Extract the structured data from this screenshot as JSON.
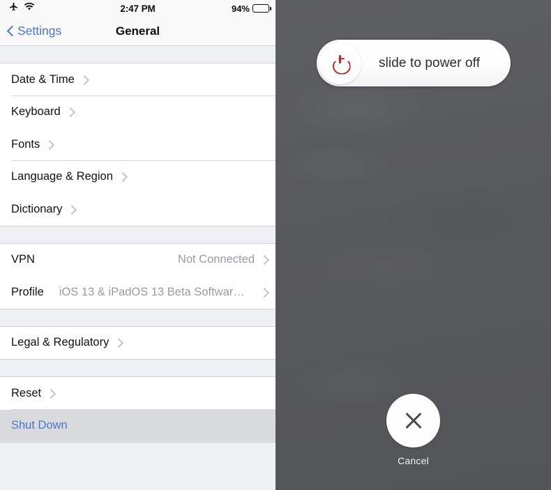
{
  "status_bar": {
    "airplane_icon": "airplane-icon",
    "wifi_icon": "wifi-icon",
    "time": "2:47 PM",
    "battery_percent": "94%",
    "battery_icon": "battery-icon"
  },
  "nav_bar": {
    "back_label": "Settings",
    "back_icon": "chevron-left-icon",
    "title": "General"
  },
  "groups": [
    {
      "rows": [
        {
          "label": "Date & Time",
          "value": "",
          "chevron": true,
          "accent": false,
          "pressed": false
        },
        {
          "label": "Keyboard",
          "value": "",
          "chevron": true,
          "accent": false,
          "pressed": false
        },
        {
          "label": "Fonts",
          "value": "",
          "chevron": true,
          "accent": false,
          "pressed": false
        },
        {
          "label": "Language & Region",
          "value": "",
          "chevron": true,
          "accent": false,
          "pressed": false
        },
        {
          "label": "Dictionary",
          "value": "",
          "chevron": true,
          "accent": false,
          "pressed": false
        }
      ]
    },
    {
      "rows": [
        {
          "label": "VPN",
          "value": "Not Connected",
          "chevron": true,
          "accent": false,
          "pressed": false
        },
        {
          "label": "Profile",
          "value": "iOS 13 & iPadOS 13 Beta Softwar…",
          "chevron": true,
          "accent": false,
          "pressed": false,
          "inline_value": true
        }
      ]
    },
    {
      "rows": [
        {
          "label": "Legal & Regulatory",
          "value": "",
          "chevron": true,
          "accent": false,
          "pressed": false
        }
      ]
    },
    {
      "rows": [
        {
          "label": "Reset",
          "value": "",
          "chevron": true,
          "accent": false,
          "pressed": false
        },
        {
          "label": "Shut Down",
          "value": "",
          "chevron": false,
          "accent": true,
          "pressed": true
        }
      ]
    }
  ],
  "power_overlay": {
    "slider_text": "slide to power off",
    "slider_icon": "power-icon",
    "cancel_label": "Cancel",
    "cancel_icon": "close-x-icon"
  },
  "colors": {
    "ios_blue": "#4a76c9",
    "power_red": "#a8342a",
    "overlay_gray": "#5a5b5f",
    "group_bg": "#eff0f4",
    "row_bg": "#ffffff",
    "pressed_row": "#d9dadd",
    "chevron_gray": "#c4c4c9",
    "value_gray": "#9a9a9f"
  }
}
